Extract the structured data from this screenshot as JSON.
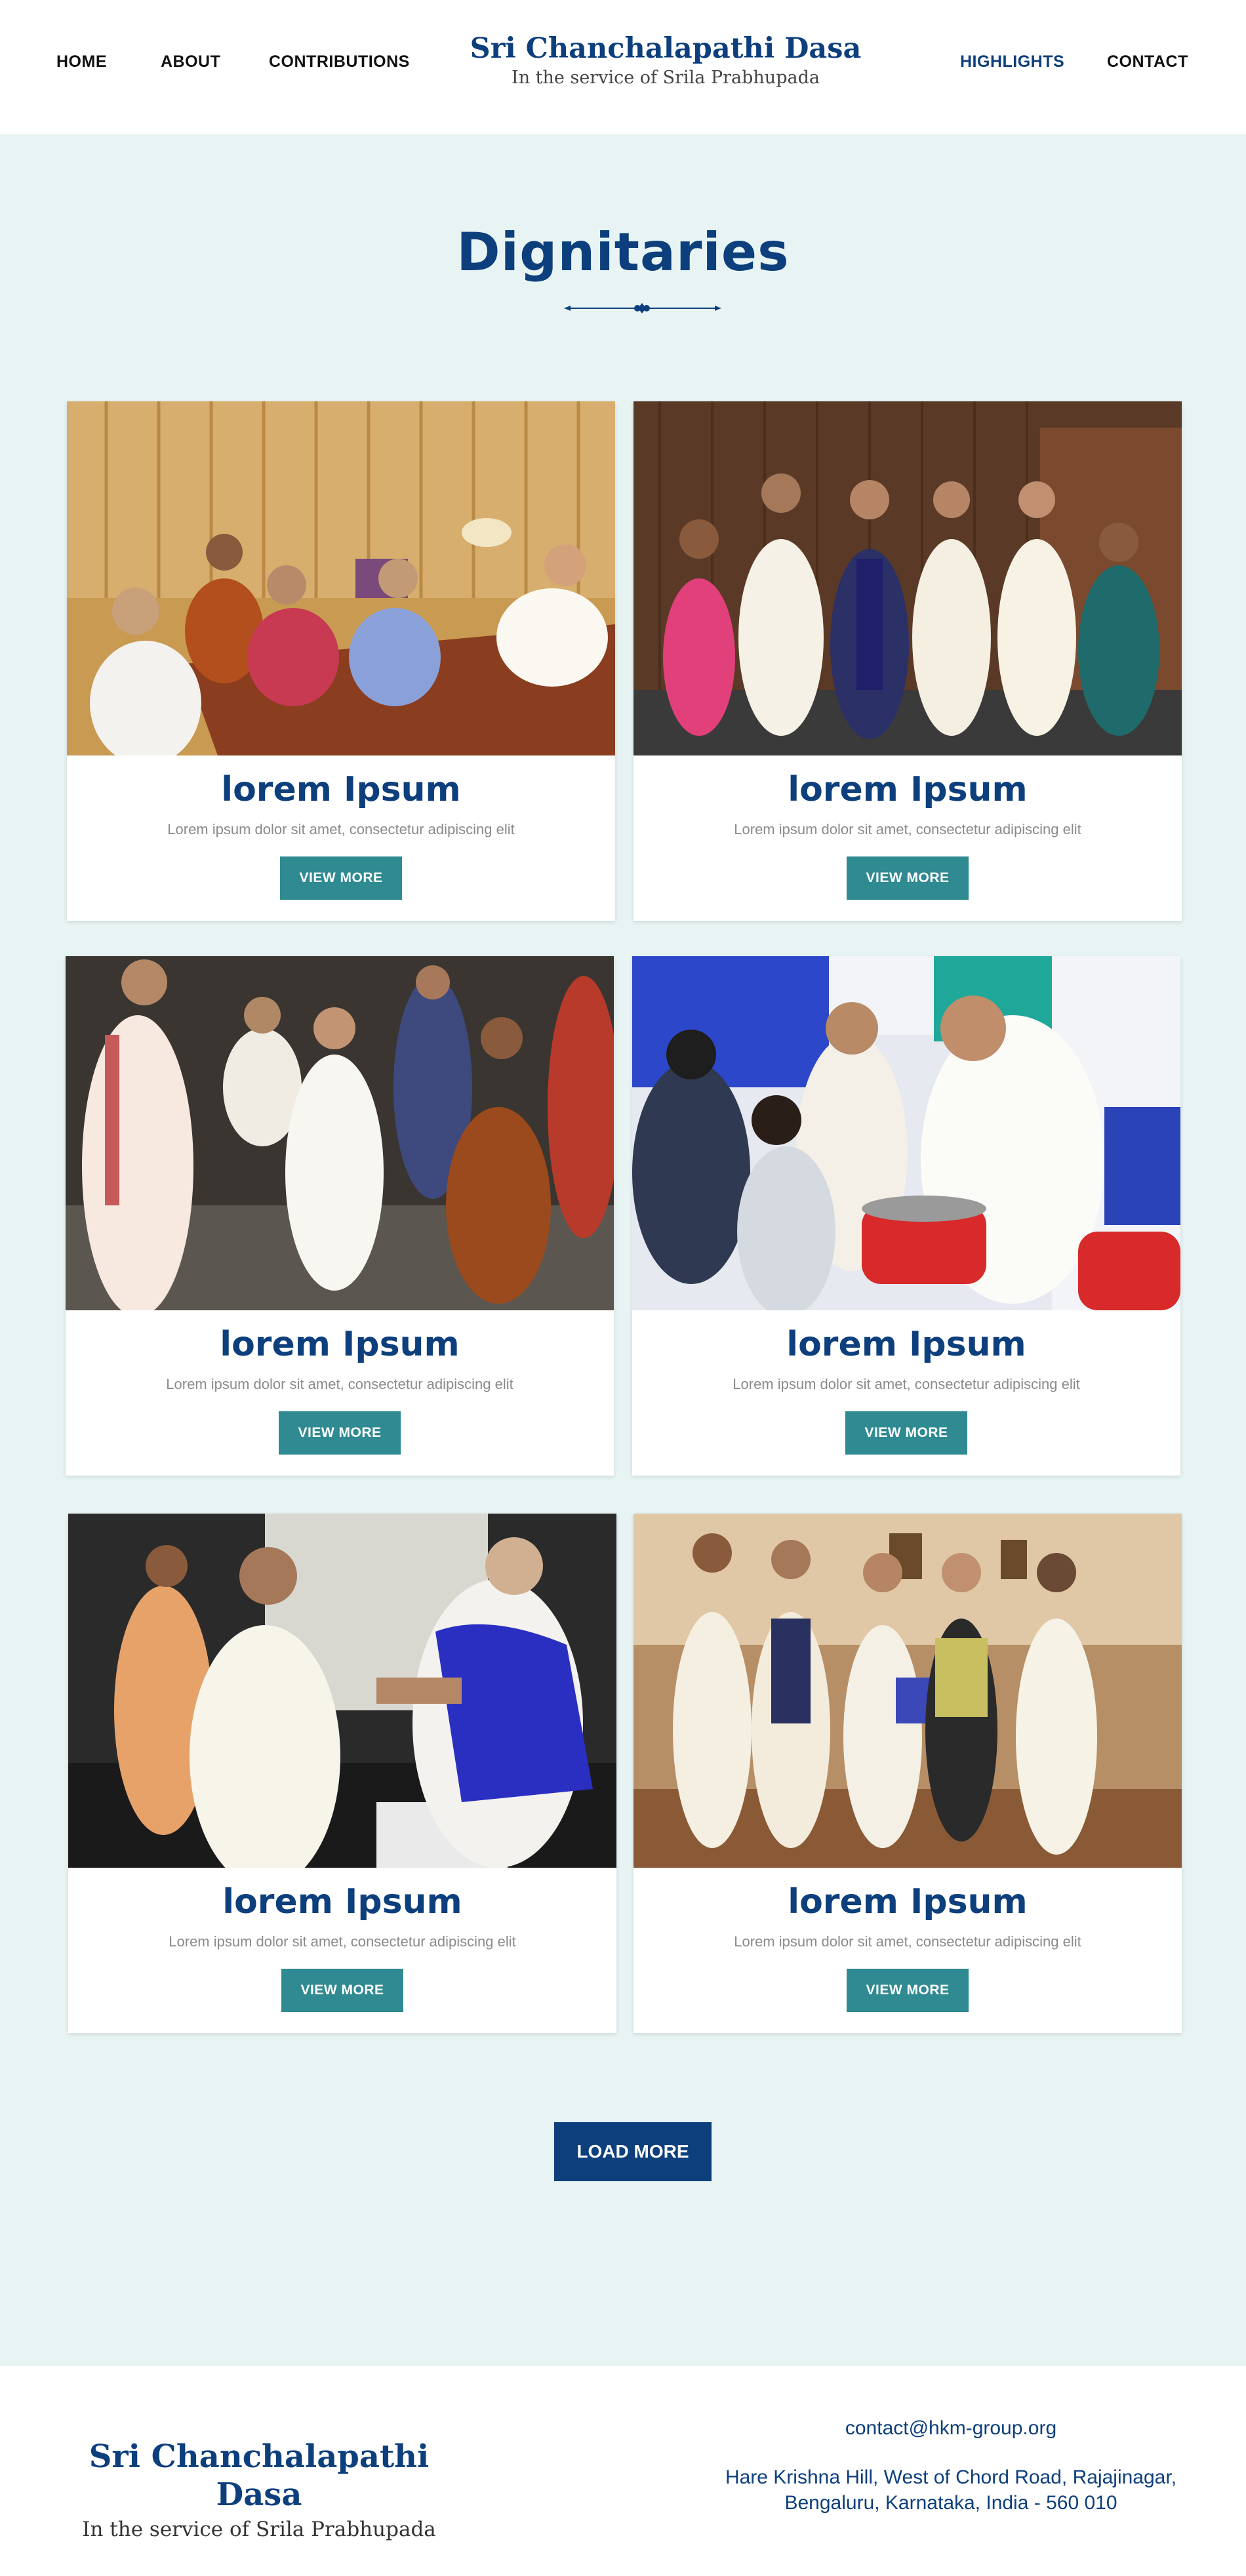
{
  "nav": {
    "left": [
      "HOME",
      "ABOUT",
      "CONTRIBUTIONS"
    ],
    "right": [
      "HIGHLIGHTS",
      "CONTACT"
    ],
    "active": "HIGHLIGHTS"
  },
  "brand": {
    "title": "Sri Chanchalapathi Dasa",
    "subtitle": "In the service of Srila Prabhupada"
  },
  "section": {
    "title": "Dignitaries"
  },
  "cards": [
    {
      "title": "lorem Ipsum",
      "description": "Lorem ipsum dolor sit amet, consectetur adipiscing elit",
      "button": "VIEW MORE"
    },
    {
      "title": "lorem Ipsum",
      "description": "Lorem ipsum dolor sit amet, consectetur adipiscing elit",
      "button": "VIEW MORE"
    },
    {
      "title": "lorem Ipsum",
      "description": "Lorem ipsum dolor sit amet, consectetur adipiscing elit",
      "button": "VIEW MORE"
    },
    {
      "title": "lorem Ipsum",
      "description": "Lorem ipsum dolor sit amet, consectetur adipiscing elit",
      "button": "VIEW MORE"
    },
    {
      "title": "lorem Ipsum",
      "description": "Lorem ipsum dolor sit amet, consectetur adipiscing elit",
      "button": "VIEW MORE"
    },
    {
      "title": "lorem Ipsum",
      "description": "Lorem ipsum dolor sit amet, consectetur adipiscing elit",
      "button": "VIEW MORE"
    }
  ],
  "load_more": "LOAD MORE",
  "footer": {
    "title": "Sri Chanchalapathi Dasa",
    "subtitle": "In the service of Srila Prabhupada",
    "email": "contact@hkm-group.org",
    "address_line1": "Hare Krishna Hill, West of Chord Road, Rajajinagar,",
    "address_line2": "Bengaluru, Karnataka, India - 560 010"
  },
  "colors": {
    "brand_blue": "#0d3f7d",
    "teal_button": "#2f8a92",
    "section_bg": "#e8f4f4"
  }
}
